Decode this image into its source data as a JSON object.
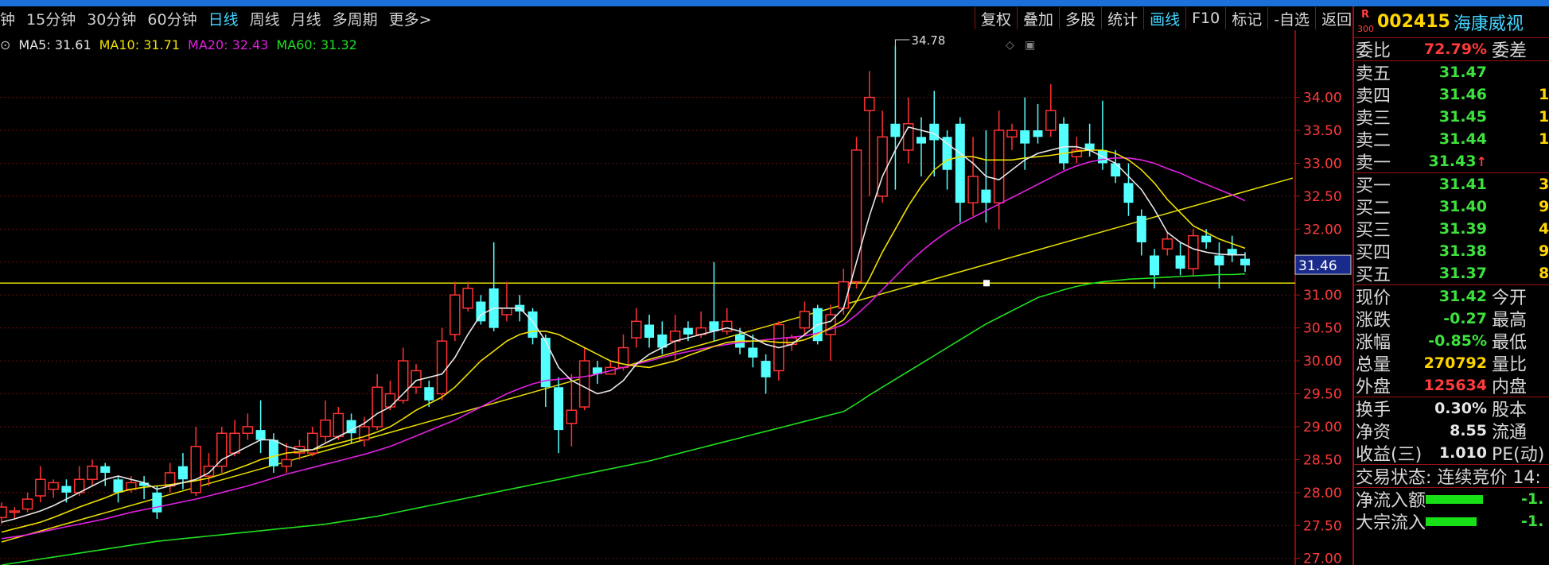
{
  "period_bar": [
    "钟",
    "15分钟",
    "30分钟",
    "60分钟",
    "日线",
    "周线",
    "月线",
    "多周期",
    "更多>"
  ],
  "period_active": "日线",
  "tool_bar": [
    "复权",
    "叠加",
    "多股",
    "统计",
    "画线",
    "F10",
    "标记",
    "-自选",
    "返回"
  ],
  "tool_active": "画线",
  "ma_legend": {
    "icon": "⊙",
    "items": [
      {
        "text": "MA5: 31.61",
        "color": "#e8e8e8"
      },
      {
        "text": "MA10: 31.71",
        "color": "#f0e000"
      },
      {
        "text": "MA20: 32.43",
        "color": "#e020e0"
      },
      {
        "text": "MA60: 31.32",
        "color": "#20e020"
      }
    ]
  },
  "chart_icons": [
    "◇",
    "▣"
  ],
  "chart_data": {
    "type": "candlestick",
    "y_axis_ticks": [
      "34.00",
      "33.50",
      "33.00",
      "32.50",
      "32.00",
      "31.50",
      "31.00",
      "30.50",
      "30.00",
      "29.50",
      "29.00",
      "28.50",
      "28.00",
      "27.50",
      "27.00"
    ],
    "y_range": [
      26.9,
      34.9
    ],
    "high_annotation": "34.78",
    "current_price_label": "31.46",
    "current_price": 31.46,
    "horizontal_line_price": 31.18,
    "trend_line": {
      "from": [
        0,
        27.25
      ],
      "to": [
        81,
        31.74
      ]
    },
    "candles": [
      [
        27.62,
        27.78,
        27.52,
        27.85
      ],
      [
        27.7,
        27.72,
        27.6,
        27.78
      ],
      [
        27.75,
        27.9,
        27.7,
        28.0
      ],
      [
        27.95,
        28.2,
        27.85,
        28.4
      ],
      [
        28.05,
        28.15,
        27.92,
        28.2
      ],
      [
        28.1,
        28.0,
        27.85,
        28.2
      ],
      [
        28.0,
        28.2,
        27.95,
        28.4
      ],
      [
        28.2,
        28.4,
        28.1,
        28.5
      ],
      [
        28.4,
        28.3,
        28.1,
        28.45
      ],
      [
        28.2,
        28.0,
        27.85,
        28.25
      ],
      [
        28.05,
        28.15,
        28.0,
        28.25
      ],
      [
        28.15,
        28.1,
        27.9,
        28.25
      ],
      [
        28.0,
        27.7,
        27.6,
        28.1
      ],
      [
        28.1,
        28.3,
        28.0,
        28.45
      ],
      [
        28.4,
        28.2,
        28.05,
        28.6
      ],
      [
        28.0,
        28.7,
        27.95,
        29.0
      ],
      [
        28.25,
        28.4,
        28.1,
        28.6
      ],
      [
        28.4,
        28.9,
        28.3,
        29.0
      ],
      [
        28.6,
        28.9,
        28.55,
        29.1
      ],
      [
        28.9,
        29.0,
        28.8,
        29.2
      ],
      [
        28.95,
        28.8,
        28.6,
        29.4
      ],
      [
        28.8,
        28.4,
        28.3,
        28.9
      ],
      [
        28.4,
        28.5,
        28.3,
        28.75
      ],
      [
        28.6,
        28.7,
        28.5,
        28.8
      ],
      [
        28.6,
        28.9,
        28.55,
        29.0
      ],
      [
        28.85,
        29.1,
        28.75,
        29.4
      ],
      [
        28.85,
        29.2,
        28.8,
        29.3
      ],
      [
        29.1,
        28.9,
        28.75,
        29.2
      ],
      [
        28.8,
        29.0,
        28.7,
        29.15
      ],
      [
        29.0,
        29.6,
        28.95,
        29.8
      ],
      [
        29.3,
        29.5,
        29.25,
        29.7
      ],
      [
        29.4,
        30.0,
        29.35,
        30.2
      ],
      [
        29.6,
        29.85,
        29.5,
        29.95
      ],
      [
        29.6,
        29.4,
        29.3,
        29.7
      ],
      [
        29.5,
        30.3,
        29.4,
        30.5
      ],
      [
        30.4,
        31.0,
        30.3,
        31.2
      ],
      [
        30.8,
        31.1,
        30.75,
        31.2
      ],
      [
        30.9,
        30.6,
        30.55,
        31.0
      ],
      [
        31.1,
        30.5,
        30.45,
        31.8
      ],
      [
        30.7,
        30.8,
        30.6,
        31.2
      ],
      [
        30.85,
        30.75,
        30.6,
        31.0
      ],
      [
        30.75,
        30.35,
        30.25,
        30.8
      ],
      [
        30.35,
        29.6,
        29.3,
        30.4
      ],
      [
        29.6,
        28.95,
        28.6,
        29.75
      ],
      [
        29.05,
        29.25,
        28.7,
        29.8
      ],
      [
        29.3,
        30.0,
        29.25,
        30.2
      ],
      [
        29.9,
        29.8,
        29.65,
        30.0
      ],
      [
        29.8,
        29.9,
        29.8,
        30.0
      ],
      [
        29.9,
        30.2,
        29.85,
        30.4
      ],
      [
        30.35,
        30.6,
        30.2,
        30.8
      ],
      [
        30.55,
        30.35,
        30.2,
        30.7
      ],
      [
        30.4,
        30.2,
        30.1,
        30.6
      ],
      [
        30.3,
        30.45,
        30.0,
        30.7
      ],
      [
        30.5,
        30.4,
        30.3,
        30.6
      ],
      [
        30.4,
        30.5,
        30.35,
        30.75
      ],
      [
        30.6,
        30.45,
        30.3,
        31.5
      ],
      [
        30.45,
        30.6,
        30.4,
        30.8
      ],
      [
        30.4,
        30.2,
        30.1,
        30.5
      ],
      [
        30.2,
        30.05,
        29.9,
        30.4
      ],
      [
        30.0,
        29.75,
        29.5,
        30.1
      ],
      [
        29.85,
        30.55,
        29.7,
        30.6
      ],
      [
        30.25,
        30.35,
        30.15,
        30.4
      ],
      [
        30.5,
        30.75,
        30.4,
        30.9
      ],
      [
        30.8,
        30.3,
        30.25,
        30.85
      ],
      [
        30.4,
        30.7,
        30.0,
        30.85
      ],
      [
        30.8,
        31.2,
        30.7,
        31.4
      ],
      [
        31.2,
        33.2,
        31.1,
        33.4
      ],
      [
        33.8,
        34.0,
        32.5,
        34.4
      ],
      [
        32.5,
        33.4,
        32.4,
        33.8
      ],
      [
        33.6,
        33.4,
        32.6,
        34.78
      ],
      [
        33.2,
        33.6,
        33.0,
        34.0
      ],
      [
        33.4,
        33.3,
        32.8,
        33.7
      ],
      [
        33.6,
        33.35,
        32.8,
        34.1
      ],
      [
        33.4,
        32.9,
        32.6,
        33.5
      ],
      [
        33.6,
        32.4,
        32.1,
        33.7
      ],
      [
        32.4,
        32.8,
        32.2,
        33.4
      ],
      [
        32.6,
        32.4,
        32.1,
        33.5
      ],
      [
        32.4,
        33.5,
        32.0,
        33.8
      ],
      [
        33.4,
        33.5,
        33.2,
        33.6
      ],
      [
        33.5,
        33.3,
        32.9,
        34.0
      ],
      [
        33.5,
        33.4,
        33.3,
        33.9
      ],
      [
        33.5,
        33.8,
        33.4,
        34.2
      ],
      [
        33.6,
        33.0,
        32.9,
        33.7
      ],
      [
        33.1,
        33.2,
        33.0,
        33.4
      ],
      [
        33.3,
        33.2,
        33.1,
        33.6
      ],
      [
        33.2,
        33.0,
        32.9,
        33.95
      ],
      [
        33.0,
        32.8,
        32.7,
        33.2
      ],
      [
        32.7,
        32.4,
        32.2,
        33.0
      ],
      [
        32.2,
        31.8,
        31.6,
        32.3
      ],
      [
        31.6,
        31.3,
        31.1,
        31.7
      ],
      [
        31.7,
        31.85,
        31.6,
        31.95
      ],
      [
        31.6,
        31.4,
        31.3,
        31.8
      ],
      [
        31.4,
        31.9,
        31.3,
        32.0
      ],
      [
        31.9,
        31.8,
        31.7,
        32.0
      ],
      [
        31.6,
        31.45,
        31.1,
        31.8
      ],
      [
        31.7,
        31.6,
        31.5,
        31.9
      ],
      [
        31.55,
        31.45,
        31.35,
        31.65
      ]
    ],
    "ma5": [
      27.55,
      27.6,
      27.66,
      27.72,
      27.8,
      27.9,
      28.0,
      28.1,
      28.2,
      28.25,
      28.2,
      28.15,
      28.05,
      28.1,
      28.15,
      28.2,
      28.3,
      28.5,
      28.6,
      28.7,
      28.8,
      28.8,
      28.7,
      28.65,
      28.65,
      28.75,
      28.85,
      28.95,
      29.05,
      29.2,
      29.3,
      29.5,
      29.7,
      29.75,
      29.8,
      30.05,
      30.4,
      30.7,
      30.8,
      30.8,
      30.8,
      30.6,
      30.3,
      29.9,
      29.7,
      29.6,
      29.5,
      29.55,
      29.7,
      29.95,
      30.1,
      30.2,
      30.3,
      30.35,
      30.4,
      30.45,
      30.5,
      30.45,
      30.35,
      30.25,
      30.2,
      30.25,
      30.4,
      30.55,
      30.6,
      30.8,
      31.5,
      32.2,
      32.8,
      33.2,
      33.55,
      33.5,
      33.45,
      33.3,
      33.15,
      33.0,
      32.8,
      32.75,
      32.9,
      33.05,
      33.15,
      33.2,
      33.25,
      33.25,
      33.2,
      33.1,
      33.0,
      32.8,
      32.6,
      32.3,
      31.95,
      31.8,
      31.7,
      31.65,
      31.62,
      31.61,
      31.61
    ],
    "ma10": [
      27.4,
      27.45,
      27.5,
      27.55,
      27.62,
      27.7,
      27.78,
      27.85,
      27.92,
      28.0,
      28.05,
      28.08,
      28.1,
      28.12,
      28.15,
      28.18,
      28.22,
      28.28,
      28.35,
      28.42,
      28.5,
      28.55,
      28.6,
      28.62,
      28.65,
      28.7,
      28.75,
      28.8,
      28.85,
      28.92,
      29.0,
      29.12,
      29.25,
      29.35,
      29.45,
      29.6,
      29.8,
      30.0,
      30.15,
      30.3,
      30.4,
      30.45,
      30.45,
      30.4,
      30.3,
      30.2,
      30.1,
      30.0,
      29.95,
      29.92,
      29.9,
      29.95,
      30.0,
      30.08,
      30.15,
      30.22,
      30.28,
      30.3,
      30.3,
      30.3,
      30.28,
      30.28,
      30.32,
      30.4,
      30.5,
      30.62,
      30.9,
      31.25,
      31.65,
      32.0,
      32.35,
      32.65,
      32.9,
      33.05,
      33.1,
      33.1,
      33.05,
      33.05,
      33.05,
      33.08,
      33.1,
      33.12,
      33.15,
      33.18,
      33.2,
      33.2,
      33.15,
      33.05,
      32.9,
      32.7,
      32.45,
      32.25,
      32.05,
      31.95,
      31.85,
      31.78,
      31.71
    ],
    "ma20": [
      27.3,
      27.33,
      27.36,
      27.4,
      27.44,
      27.48,
      27.52,
      27.56,
      27.6,
      27.65,
      27.7,
      27.74,
      27.78,
      27.82,
      27.86,
      27.9,
      27.95,
      28.0,
      28.05,
      28.1,
      28.16,
      28.22,
      28.28,
      28.33,
      28.38,
      28.43,
      28.48,
      28.53,
      28.58,
      28.64,
      28.7,
      28.78,
      28.86,
      28.94,
      29.02,
      29.1,
      29.2,
      29.3,
      29.4,
      29.5,
      29.58,
      29.65,
      29.7,
      29.72,
      29.74,
      29.76,
      29.8,
      29.85,
      29.9,
      29.95,
      30.0,
      30.05,
      30.1,
      30.14,
      30.18,
      30.22,
      30.25,
      30.28,
      30.3,
      30.32,
      30.34,
      30.36,
      30.38,
      30.42,
      30.48,
      30.55,
      30.7,
      30.88,
      31.08,
      31.28,
      31.48,
      31.66,
      31.82,
      31.96,
      32.08,
      32.18,
      32.28,
      32.38,
      32.48,
      32.58,
      32.68,
      32.78,
      32.88,
      32.96,
      33.02,
      33.06,
      33.08,
      33.08,
      33.05,
      33.0,
      32.92,
      32.85,
      32.76,
      32.68,
      32.6,
      32.52,
      32.43
    ],
    "ma60": [
      26.9,
      26.93,
      26.96,
      26.99,
      27.02,
      27.05,
      27.08,
      27.11,
      27.14,
      27.17,
      27.2,
      27.23,
      27.26,
      27.28,
      27.3,
      27.32,
      27.34,
      27.36,
      27.38,
      27.4,
      27.42,
      27.44,
      27.46,
      27.48,
      27.5,
      27.52,
      27.55,
      27.58,
      27.61,
      27.64,
      27.68,
      27.72,
      27.76,
      27.8,
      27.84,
      27.88,
      27.92,
      27.96,
      28.0,
      28.04,
      28.08,
      28.12,
      28.16,
      28.2,
      28.24,
      28.28,
      28.32,
      28.36,
      28.4,
      28.44,
      28.48,
      28.53,
      28.58,
      28.63,
      28.68,
      28.73,
      28.78,
      28.83,
      28.88,
      28.93,
      28.98,
      29.03,
      29.08,
      29.13,
      29.18,
      29.23,
      29.35,
      29.48,
      29.6,
      29.72,
      29.84,
      29.96,
      30.08,
      30.2,
      30.32,
      30.44,
      30.56,
      30.66,
      30.76,
      30.86,
      30.96,
      31.02,
      31.08,
      31.13,
      31.17,
      31.2,
      31.22,
      31.24,
      31.25,
      31.26,
      31.27,
      31.28,
      31.29,
      31.3,
      31.31,
      31.31,
      31.32
    ]
  },
  "quote": {
    "badge_r": "R",
    "badge_num": "300",
    "code": "002415",
    "name": "海康威视",
    "weibi": {
      "label": "委比",
      "value": "72.79%",
      "label2": "委差"
    },
    "sell": [
      {
        "label": "卖五",
        "price": "31.47",
        "vol": ""
      },
      {
        "label": "卖四",
        "price": "31.46",
        "vol": "1"
      },
      {
        "label": "卖三",
        "price": "31.45",
        "vol": "1"
      },
      {
        "label": "卖二",
        "price": "31.44",
        "vol": "1"
      },
      {
        "label": "卖一",
        "price": "31.43",
        "arrow": "↑",
        "vol": ""
      }
    ],
    "buy": [
      {
        "label": "买一",
        "price": "31.41",
        "vol": "3"
      },
      {
        "label": "买二",
        "price": "31.40",
        "vol": "9"
      },
      {
        "label": "买三",
        "price": "31.39",
        "vol": "4"
      },
      {
        "label": "买四",
        "price": "31.38",
        "vol": "9"
      },
      {
        "label": "买五",
        "price": "31.37",
        "vol": "8"
      }
    ],
    "stats1": [
      {
        "label": "现价",
        "value": "31.42",
        "cls": "green",
        "label2": "今开"
      },
      {
        "label": "涨跌",
        "value": "-0.27",
        "cls": "green",
        "label2": "最高"
      },
      {
        "label": "涨幅",
        "value": "-0.85%",
        "cls": "green",
        "label2": "最低"
      },
      {
        "label": "总量",
        "value": "270792",
        "cls": "yellow",
        "label2": "量比"
      },
      {
        "label": "外盘",
        "value": "125634",
        "cls": "red",
        "label2": "内盘"
      }
    ],
    "stats2": [
      {
        "label": "换手",
        "value": "0.30%",
        "cls": "white",
        "label2": "股本"
      },
      {
        "label": "净资",
        "value": "8.55",
        "cls": "white",
        "label2": "流通"
      },
      {
        "label": "收益(三)",
        "value": "1.010",
        "cls": "white",
        "label2": "PE(动)"
      }
    ],
    "trade_status": "交易状态: 连续竞价 14:",
    "flows": [
      {
        "label": "净流入额",
        "value": "-1.",
        "bar": 0.9
      },
      {
        "label": "大宗流入",
        "value": "-1.",
        "bar": 0.8
      }
    ]
  }
}
